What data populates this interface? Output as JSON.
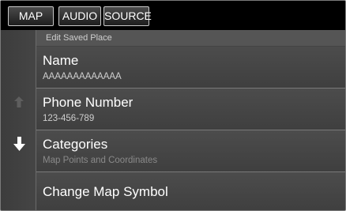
{
  "tabs": [
    {
      "label": "MAP"
    },
    {
      "label": "AUDIO"
    },
    {
      "label": "SOURCE"
    }
  ],
  "screen": {
    "header": "Edit Saved Place"
  },
  "items": [
    {
      "title": "Name",
      "subtitle": "AAAAAAAAAAAAA"
    },
    {
      "title": "Phone Number",
      "subtitle": "123-456-789"
    },
    {
      "title": "Categories",
      "subtitle": "Map Points and Coordinates"
    },
    {
      "title": "Change Map Symbol",
      "subtitle": ""
    }
  ],
  "colors": {
    "background": "#444444",
    "tab_bar": "#000000",
    "text": "#ffffff",
    "subtext": "#cfcfcf",
    "disabled_subtext": "#8a8a8a"
  },
  "icons": {
    "scroll_up": "arrow-up-icon",
    "scroll_down": "arrow-down-icon"
  }
}
